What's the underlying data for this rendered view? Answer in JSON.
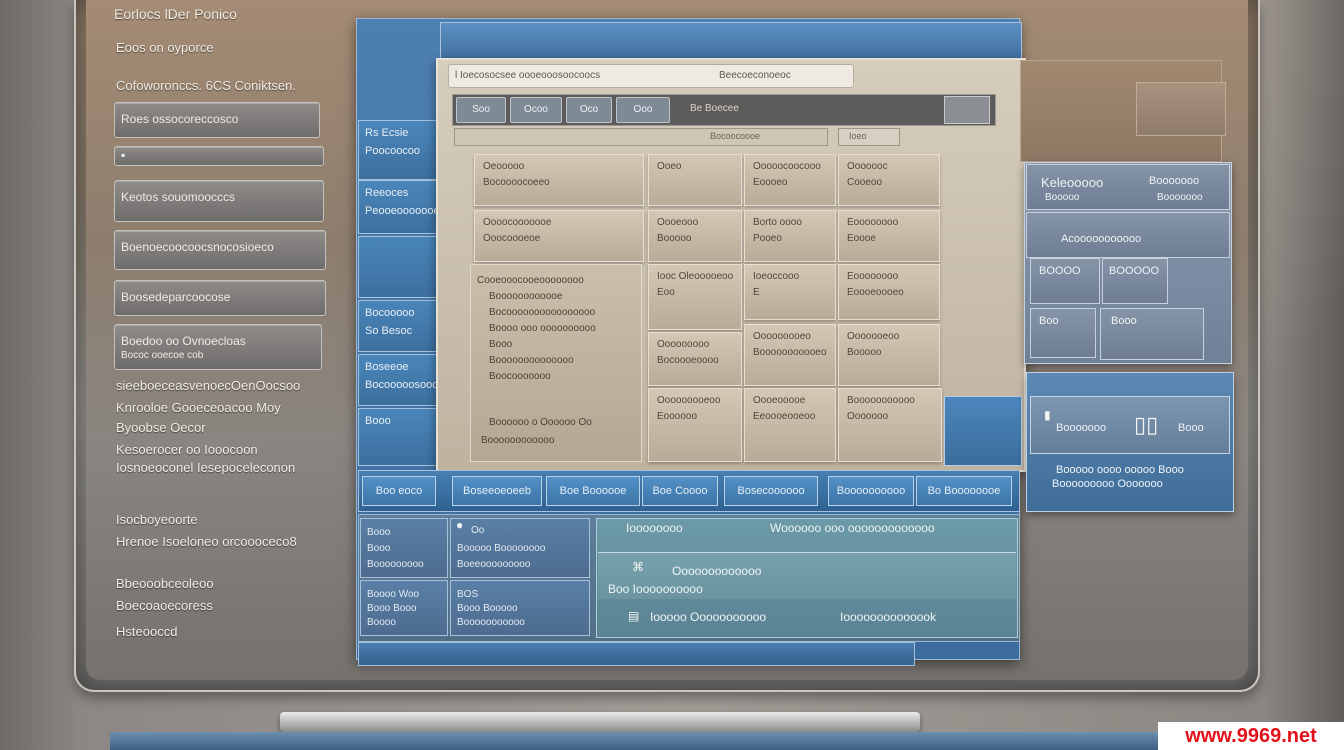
{
  "sidebar": {
    "heading1": "Eorlocs lDer Ponico",
    "heading2": "Eoos on oyporce",
    "heading3": "Cofoworonccs. 6CS Coniktsen.",
    "box1": "Roes ossocoreccosco",
    "box2": "",
    "box3": "Keotos souomoocccs",
    "box4": "Boenoecoocoocsnocosioeco",
    "box5": "Boosedeparcoocose",
    "box6_line1": "Boedoo oo Ovnoecloas",
    "box6_line2": "Bococ ooecoe cob",
    "para_lines": [
      "sieeboeceasvenoecOenOocsoo",
      "Knrooloe Gooeceoacoo Moy",
      "Byoobse Oecor",
      "Kesoerocer oo Iooocoon",
      "Iosnoeoconel Iesepoceleconon"
    ],
    "lower_lines": [
      "Isocboyeoorte",
      "Hrenoe Isoeloneo orcoooceco8",
      "Bbeooobceoleoo",
      "Boecoaoecoress",
      "Hsteooccd"
    ]
  },
  "side_tabs": [
    {
      "label": "Rs Ecsie",
      "sub": "Poocoocoo"
    },
    {
      "label": "Reeoces",
      "sub": "Peooeooooooe"
    },
    {
      "label": "",
      "sub": ""
    },
    {
      "label": "Bocooooo",
      "sub": "So Besoc"
    },
    {
      "label": "Boseeoe",
      "sub": "Bocooooosooo"
    },
    {
      "label": "Booo",
      "sub": ""
    }
  ],
  "browser": {
    "address": "l Ioecosocsee oooeooosoocoocs",
    "address_right": "Beecoeconoeoc",
    "toolbar_buttons": [
      "Soo",
      "Ocoo",
      "Oco",
      "Ooo"
    ],
    "toolbar_title": "Be Boecee",
    "search_text": "Bocoocoooe",
    "search_right": "Ioeo"
  },
  "grid": {
    "cells": [
      {
        "l1": "Oeooooo",
        "l2": "Bocoooocoeeo"
      },
      {
        "l1": "Ooeo",
        "l2": ""
      },
      {
        "l1": "Ooooocoocooo",
        "l2": "Eoooeo"
      },
      {
        "l1": "Ooooooc",
        "l2": "Cooeoo"
      },
      {
        "l1": "Oooocooooooe",
        "l2": "Ooocoooeoe"
      },
      {
        "l1": "Oooeooo",
        "l2": "Booooo"
      },
      {
        "l1": "Borto oooo",
        "l2": "Pooeo"
      },
      {
        "l1": "Eoooooooo",
        "l2": "Eoooe"
      },
      {
        "l1": "Iooc Oleooooeoo",
        "l2": "Eoo"
      },
      {
        "l1": "Ioeoccooo",
        "l2": "E"
      },
      {
        "l1": "Eoooooooo",
        "l2": "Eoooeoooeo"
      },
      {
        "l1": "Ooooooooo",
        "l2": "Bocoooeoooo"
      },
      {
        "l1": "Ooooooooeo",
        "l2": "Booooooooooeo"
      },
      {
        "l1": "Ooooooeoo",
        "l2": "Booooo"
      },
      {
        "l1": "Ooooooooeoo",
        "l2": "Eoooooo"
      },
      {
        "l1": "Oooeooooe",
        "l2": "Eeoooeooeoo"
      },
      {
        "l1": "Booooooooooo",
        "l2": "Ooooooo"
      }
    ],
    "big_lines": [
      "Cooeooocooeoooooooo",
      "Boooooooooooe",
      "Bocoooooooooooooooo",
      "Boooo ooo oooooooooo",
      "Booo",
      "Boooooooooooooo",
      "Boocooooooo",
      "Boooooo o Oooooo Oo",
      "Boooooooooooo"
    ]
  },
  "tabs": [
    "Boo eoco",
    "Boseeoeoeeb",
    "Boe Boooooe",
    "Boe Coooo",
    "Bosecoooooo",
    "Boooooooooo",
    "Bo Boooooooe"
  ],
  "bottom": {
    "left_cells": [
      {
        "l1": "Booo",
        "l2": "Booo",
        "l3": "Booooooooo"
      },
      {
        "l1": "Oo",
        "l2": "Booooo Boooooooo",
        "l3": "Boeeooooooooo"
      },
      {
        "l1": "Boooo Woo",
        "l2": "Booo Booo",
        "l3": "Boooo"
      },
      {
        "l1": "BOS",
        "l2": "Booo Booooo",
        "l3": "Booooooooooo"
      }
    ],
    "right_head1": "Ioooooooo",
    "right_head2": "Woooooo ooo ooooooooooooo",
    "inner_row1": "Ooooooooooooo",
    "inner_row2": "Boo Ioooooooooo",
    "row3_left": "Iooooo Ooooooooooo",
    "row3_right": "Ioooooooooooook"
  },
  "right_panel": {
    "top_left": "Keleooooo",
    "top_left_sub": "Booooo",
    "top_right": "Booooooo",
    "top_right_sub": "Booooooo",
    "mid": "Acooooooooooo",
    "btn1": "BOOOO",
    "btn2": "BOOOOO",
    "btn3": "Boo",
    "btn4": "Booo"
  },
  "blue_panel": {
    "left": "Booooooo",
    "right": "Booo",
    "line1": "Booooo oooo ooooo Booo",
    "line2": "Booooooooo Ooooooo"
  },
  "watermark": "www.9969.net"
}
